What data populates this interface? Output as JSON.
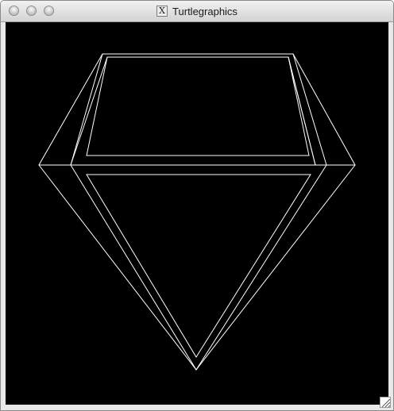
{
  "window": {
    "title": "Turtlegraphics",
    "app_icon": "x11-icon",
    "app_icon_glyph": "X",
    "controls": [
      "close-button",
      "minimize-button",
      "zoom-button"
    ]
  },
  "canvas": {
    "background_color": "#000000",
    "stroke_color": "#ffffff",
    "shape": "diamond-outline"
  },
  "resize_grip": {
    "icon": "resize-grip-icon"
  }
}
